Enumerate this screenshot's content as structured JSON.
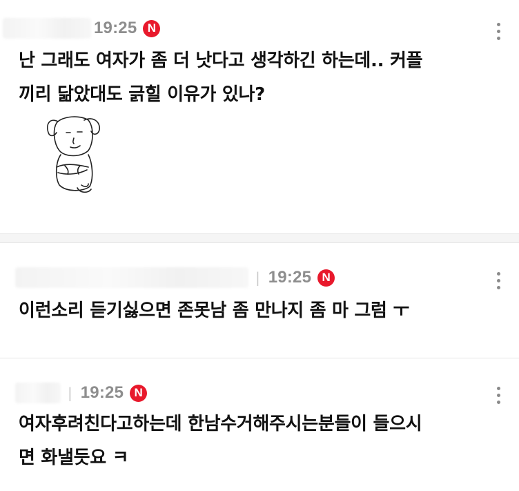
{
  "comments": [
    {
      "time": "19:25",
      "badge": "N",
      "text_lines": [
        "난 그래도 여자가 좀 더 낫다고 생각하긴 하는데.. 커플",
        "끼리 닮았대도 긁힐 이유가 있나?"
      ],
      "has_sticker": true
    },
    {
      "time": "19:25",
      "badge": "N",
      "text_lines": [
        "이런소리 듣기싫으면 존못남 좀 만나지 좀 마 그럼 ㅜ"
      ]
    },
    {
      "time": "19:25",
      "badge": "N",
      "text_lines": [
        "여자후려친다고하는데 한남수거해주시는분들이 들으시",
        "면 화낼듯요 ㅋ"
      ]
    }
  ],
  "icons": {
    "badge": "naver-n-icon",
    "more": "more-vertical-icon",
    "sticker": "cartoon-dog-sticker"
  },
  "colors": {
    "badge": "#e8192c",
    "time": "#8e8e8e",
    "text": "#111111"
  }
}
